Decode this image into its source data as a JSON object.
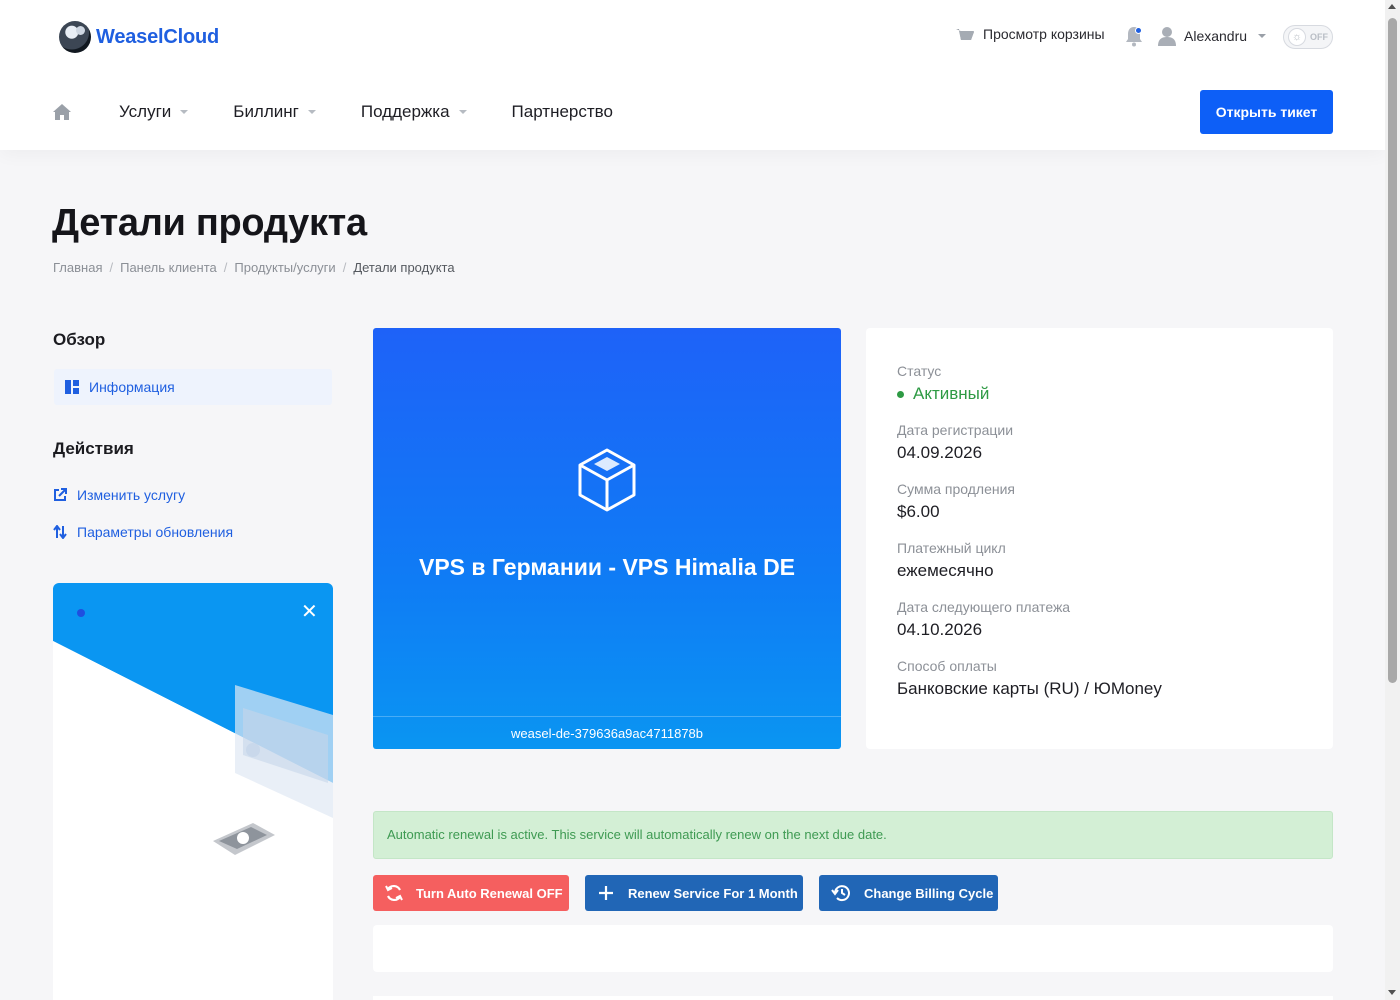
{
  "brand": {
    "name": "WeaselCloud"
  },
  "topbar": {
    "cart_label": "Просмотр корзины",
    "user_name": "Alexandru",
    "theme_toggle_label": "OFF",
    "icons": [
      "cart-icon",
      "bell-icon",
      "user-icon",
      "sun-icon"
    ]
  },
  "nav": {
    "items": [
      {
        "label": "Услуги",
        "has_dropdown": true
      },
      {
        "label": "Биллинг",
        "has_dropdown": true
      },
      {
        "label": "Поддержка",
        "has_dropdown": true
      },
      {
        "label": "Партнерство",
        "has_dropdown": false
      }
    ],
    "ticket_button": "Открыть тикет"
  },
  "page": {
    "title": "Детали продукта",
    "breadcrumb": [
      "Главная",
      "Панель клиента",
      "Продукты/услуги",
      "Детали продукта"
    ]
  },
  "sidebar": {
    "overview_heading": "Обзор",
    "overview_item": "Информация",
    "actions_heading": "Действия",
    "actions": [
      "Изменить услугу",
      "Параметры обновления"
    ]
  },
  "product": {
    "name": "VPS в Германии - VPS Himalia DE",
    "hostname": "weasel-de-379636a9ac4711878b"
  },
  "details": {
    "status_label": "Статус",
    "status_value": "Активный",
    "reg_date_label": "Дата регистрации",
    "reg_date_value": "04.09.2026",
    "renewal_amount_label": "Сумма продления",
    "renewal_amount_value": "$6.00",
    "billing_cycle_label": "Платежный цикл",
    "billing_cycle_value": "ежемесячно",
    "next_due_label": "Дата следующего платежа",
    "next_due_value": "04.10.2026",
    "payment_method_label": "Способ оплаты",
    "payment_method_value": "Банковские карты (RU) / ЮMoney"
  },
  "renewal": {
    "alert_text": "Automatic renewal is active. This service will automatically renew on the next due date.",
    "buttons": [
      "Turn Auto Renewal OFF",
      "Renew Service For 1 Month",
      "Change Billing Cycle"
    ]
  },
  "colors": {
    "accent": "#0d5ff7",
    "link": "#1f5fe0",
    "status_active": "#2e9a44",
    "danger_button": "#f55f5f",
    "action_button": "#2166b6",
    "alert_bg": "#d3efd5"
  }
}
